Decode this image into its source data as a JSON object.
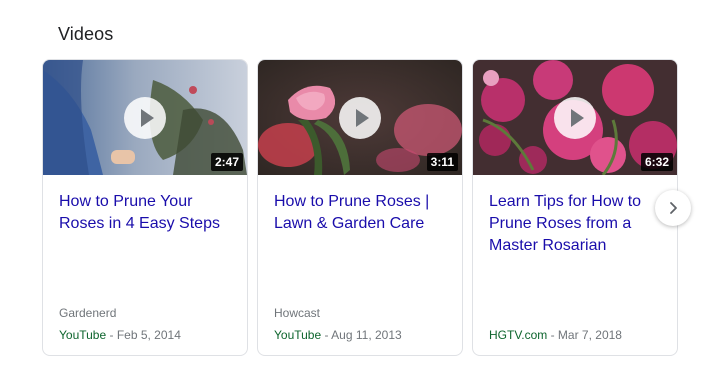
{
  "section": {
    "title": "Videos"
  },
  "videos": [
    {
      "title": "How to Prune Your Roses in 4 Easy Steps",
      "duration": "2:47",
      "channel": "Gardenerd",
      "source": "YouTube",
      "date": "Feb 5, 2014"
    },
    {
      "title": "How to Prune Roses | Lawn & Garden Care",
      "duration": "3:11",
      "channel": "Howcast",
      "source": "YouTube",
      "date": "Aug 11, 2013"
    },
    {
      "title": "Learn Tips for How to Prune Roses from a Master Rosarian",
      "duration": "6:32",
      "channel": "",
      "source": "HGTV.com",
      "date": "Mar 7, 2018"
    }
  ],
  "meta_separator": " - ",
  "icons": {
    "play": "play-icon",
    "next": "chevron-right-icon"
  },
  "colors": {
    "title_link": "#1a0dab",
    "source": "#0d652d",
    "muted": "#70757a"
  }
}
